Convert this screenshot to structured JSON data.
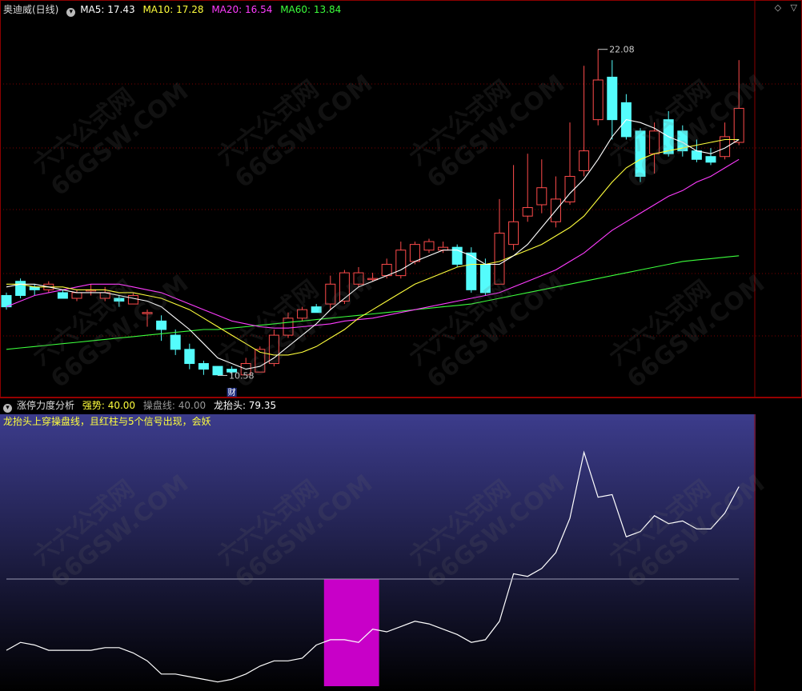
{
  "main_panel": {
    "stock_name": "奥迪威(日线)",
    "ma5_label": "MA5: 17.43",
    "ma10_label": "MA10: 17.28",
    "ma20_label": "MA20: 16.54",
    "ma60_label": "MA60: 13.84",
    "high_marker": "22.08",
    "low_marker": "10.58",
    "event_tag": "财"
  },
  "sub_panel": {
    "indicator_name": "涨停力度分析",
    "strength_label": "强势: 40.00",
    "control_line_label": "操盘线: 40.00",
    "dragon_label": "龙抬头: 79.35",
    "signal_note": "龙抬头上穿操盘线，且红柱与5个信号出现，会妖"
  },
  "watermark": {
    "line1": "六六公式网",
    "line2": "66GSW.COM"
  },
  "colors": {
    "up": "#ff4b4b",
    "down": "#54fcfc",
    "ma5": "#ffffff",
    "ma10": "#ffff3c",
    "ma20": "#ff3cff",
    "ma60": "#3cff3c",
    "bar": "#c800c8",
    "sub_bg_top": "#3c3c8c"
  },
  "chart_data": [
    {
      "type": "candlestick",
      "title": "奥迪威(日线)",
      "x": [
        1,
        2,
        3,
        4,
        5,
        6,
        7,
        8,
        9,
        10,
        11,
        12,
        13,
        14,
        15,
        16,
        17,
        18,
        19,
        20,
        21,
        22,
        23,
        24,
        25,
        26,
        27,
        28,
        29,
        30,
        31,
        32,
        33,
        34,
        35,
        36,
        37,
        38,
        39,
        40,
        41,
        42,
        43,
        44,
        45,
        46,
        47,
        48,
        49,
        50,
        51,
        52,
        53
      ],
      "open": [
        13.4,
        13.9,
        13.7,
        13.6,
        13.5,
        13.3,
        13.6,
        13.3,
        13.3,
        13.1,
        12.8,
        12.5,
        12.0,
        11.5,
        11.0,
        10.9,
        10.8,
        10.6,
        10.7,
        11.0,
        12.0,
        12.6,
        13.0,
        13.1,
        13.2,
        13.8,
        14.0,
        14.1,
        14.1,
        14.6,
        15.0,
        15.0,
        15.1,
        14.9,
        14.5,
        13.8,
        15.2,
        16.2,
        16.6,
        16.0,
        16.7,
        17.8,
        19.6,
        21.1,
        20.2,
        19.2,
        18.4,
        19.6,
        19.2,
        18.5,
        18.3,
        18.3,
        18.8
      ],
      "close": [
        13.0,
        13.4,
        13.6,
        13.8,
        13.3,
        13.5,
        13.6,
        13.5,
        13.2,
        13.4,
        12.8,
        12.2,
        11.5,
        11.0,
        10.8,
        10.6,
        10.7,
        11.0,
        11.5,
        12.0,
        12.6,
        12.9,
        12.8,
        13.8,
        14.2,
        14.2,
        14.0,
        14.5,
        15.0,
        15.2,
        15.3,
        15.1,
        14.5,
        13.6,
        13.5,
        15.6,
        16.0,
        16.5,
        17.2,
        16.8,
        17.6,
        18.5,
        21.0,
        19.6,
        19.0,
        17.6,
        19.2,
        18.4,
        18.5,
        18.2,
        18.1,
        19.0,
        20.0
      ],
      "high": [
        13.5,
        14.0,
        13.8,
        13.9,
        13.6,
        13.6,
        13.8,
        13.7,
        13.4,
        13.5,
        12.9,
        12.7,
        12.2,
        11.7,
        11.1,
        10.9,
        10.9,
        11.2,
        11.6,
        12.2,
        12.8,
        13.0,
        13.1,
        14.1,
        14.3,
        14.4,
        14.2,
        14.7,
        15.3,
        15.3,
        15.4,
        15.3,
        15.2,
        15.1,
        14.7,
        16.8,
        18.0,
        18.4,
        18.2,
        17.6,
        19.5,
        21.5,
        22.08,
        21.7,
        20.5,
        19.3,
        19.5,
        19.9,
        19.4,
        18.9,
        18.6,
        19.5,
        21.7
      ],
      "low": [
        12.9,
        13.3,
        13.4,
        13.5,
        13.3,
        13.2,
        13.4,
        13.2,
        13.0,
        13.1,
        12.3,
        11.8,
        11.3,
        10.8,
        10.6,
        10.58,
        10.6,
        10.6,
        10.7,
        10.9,
        11.9,
        12.5,
        12.8,
        12.9,
        13.1,
        13.7,
        13.9,
        14.0,
        14.0,
        14.5,
        14.9,
        14.9,
        14.4,
        13.5,
        13.4,
        13.8,
        15.0,
        16.0,
        16.3,
        15.8,
        16.6,
        17.6,
        19.4,
        18.9,
        18.9,
        17.4,
        17.7,
        18.3,
        18.3,
        18.1,
        18.0,
        18.2,
        18.7
      ],
      "ma5": [
        13.7,
        13.8,
        13.8,
        13.7,
        13.6,
        13.5,
        13.5,
        13.5,
        13.4,
        13.3,
        13.2,
        13.0,
        12.6,
        12.2,
        11.7,
        11.2,
        11.0,
        10.8,
        10.9,
        11.2,
        11.6,
        12.0,
        12.4,
        12.9,
        13.3,
        13.7,
        13.9,
        14.1,
        14.3,
        14.6,
        14.8,
        15.0,
        15.0,
        14.8,
        14.5,
        14.5,
        14.8,
        15.2,
        15.8,
        16.4,
        17.0,
        17.5,
        18.2,
        19.0,
        19.6,
        19.5,
        19.3,
        19.0,
        18.8,
        18.5,
        18.4,
        18.6,
        18.9
      ],
      "ma10": [
        13.8,
        13.8,
        13.7,
        13.7,
        13.7,
        13.6,
        13.6,
        13.6,
        13.5,
        13.5,
        13.4,
        13.3,
        13.1,
        12.9,
        12.6,
        12.3,
        12.0,
        11.7,
        11.4,
        11.3,
        11.3,
        11.4,
        11.6,
        11.9,
        12.2,
        12.6,
        12.9,
        13.2,
        13.5,
        13.8,
        14.0,
        14.2,
        14.4,
        14.5,
        14.5,
        14.6,
        14.8,
        15.0,
        15.2,
        15.5,
        15.8,
        16.2,
        16.8,
        17.4,
        17.9,
        18.2,
        18.4,
        18.5,
        18.6,
        18.7,
        18.8,
        18.9,
        18.9
      ],
      "ma20": [
        13.0,
        13.2,
        13.4,
        13.5,
        13.6,
        13.7,
        13.8,
        13.8,
        13.8,
        13.7,
        13.6,
        13.5,
        13.3,
        13.1,
        12.9,
        12.7,
        12.5,
        12.4,
        12.3,
        12.25,
        12.25,
        12.3,
        12.35,
        12.4,
        12.5,
        12.55,
        12.6,
        12.7,
        12.8,
        12.9,
        13.0,
        13.1,
        13.2,
        13.3,
        13.4,
        13.5,
        13.7,
        13.9,
        14.1,
        14.3,
        14.6,
        14.9,
        15.3,
        15.7,
        16.0,
        16.3,
        16.6,
        16.9,
        17.1,
        17.4,
        17.6,
        17.9,
        18.2
      ],
      "ma60": [
        11.5,
        11.55,
        11.6,
        11.65,
        11.7,
        11.75,
        11.8,
        11.85,
        11.9,
        11.95,
        12.0,
        12.05,
        12.1,
        12.15,
        12.2,
        12.2,
        12.25,
        12.3,
        12.35,
        12.4,
        12.45,
        12.5,
        12.55,
        12.6,
        12.65,
        12.7,
        12.75,
        12.8,
        12.85,
        12.9,
        12.95,
        13.0,
        13.05,
        13.1,
        13.2,
        13.3,
        13.4,
        13.5,
        13.6,
        13.7,
        13.8,
        13.9,
        14.0,
        14.1,
        14.2,
        14.3,
        14.4,
        14.5,
        14.6,
        14.65,
        14.7,
        14.75,
        14.8
      ],
      "ylim": [
        10.0,
        23.2
      ],
      "grid": true,
      "annotations": [
        {
          "x": 43,
          "y": 22.08,
          "text": "22.08"
        },
        {
          "x": 16,
          "y": 10.58,
          "text": "10.58"
        },
        {
          "x": 17,
          "text": "财"
        }
      ]
    },
    {
      "type": "line",
      "title": "涨停力度分析",
      "x": [
        1,
        2,
        3,
        4,
        5,
        6,
        7,
        8,
        9,
        10,
        11,
        12,
        13,
        14,
        15,
        16,
        17,
        18,
        19,
        20,
        21,
        22,
        23,
        24,
        25,
        26,
        27,
        28,
        29,
        30,
        31,
        32,
        33,
        34,
        35,
        36,
        37,
        38,
        39,
        40,
        41,
        42,
        43,
        44,
        45,
        46,
        47,
        48,
        49,
        50,
        51,
        52,
        53
      ],
      "series": [
        {
          "name": "龙抬头",
          "values": [
            13,
            16,
            15,
            13,
            13,
            13,
            13,
            14,
            14,
            12,
            9,
            4,
            4,
            3,
            2,
            1,
            2,
            4,
            7,
            9,
            9,
            10,
            15,
            17,
            17,
            16,
            21,
            20,
            22,
            24,
            23,
            21,
            19,
            16,
            17,
            24,
            42,
            41,
            44,
            50,
            63,
            88,
            71,
            72,
            56,
            58,
            64,
            61,
            62,
            59,
            59,
            65,
            75
          ]
        },
        {
          "name": "操盘线",
          "values": [
            40,
            40,
            40,
            40,
            40,
            40,
            40,
            40,
            40,
            40,
            40,
            40,
            40,
            40,
            40,
            40,
            40,
            40,
            40,
            40,
            40,
            40,
            40,
            40,
            40,
            40,
            40,
            40,
            40,
            40,
            40,
            40,
            40,
            40,
            40,
            40,
            40,
            40,
            40,
            40,
            40,
            40,
            40,
            40,
            40,
            40,
            40,
            40,
            40,
            40,
            40,
            40,
            40
          ]
        }
      ],
      "bars": [
        {
          "x_start": 24,
          "x_end": 27,
          "value": 40,
          "name": "强势"
        }
      ],
      "ylim": [
        0,
        100
      ]
    }
  ]
}
